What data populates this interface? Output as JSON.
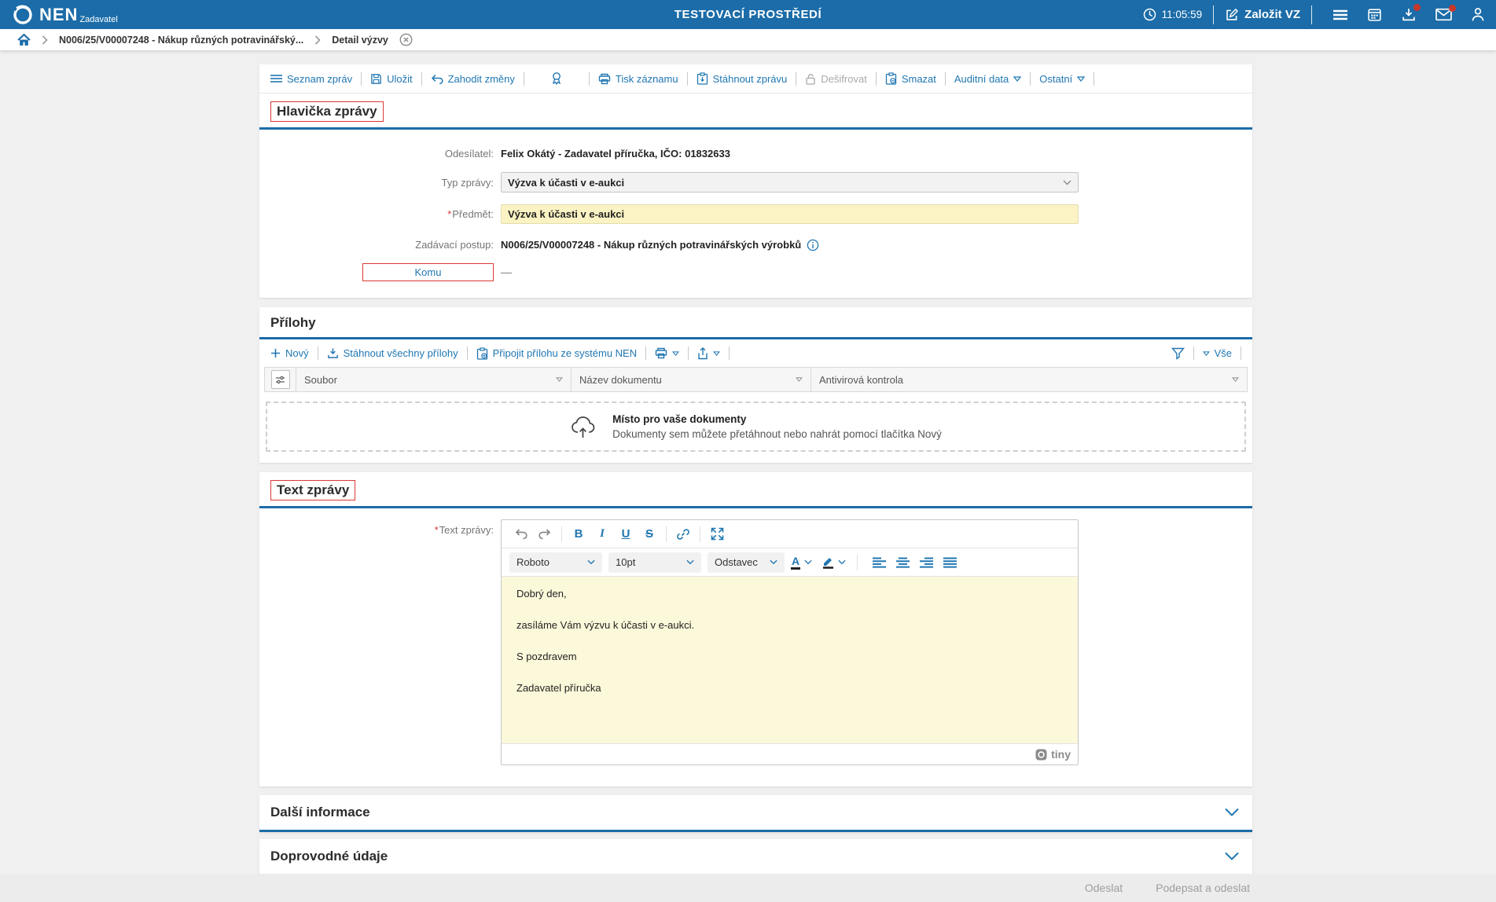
{
  "header": {
    "brand": "NEN",
    "brand_sub": "Zadavatel",
    "env_title": "TESTOVACÍ PROSTŘEDÍ",
    "time": "11:05:59",
    "create_vz": "Založit VZ"
  },
  "breadcrumb": {
    "procedure": "N006/25/V00007248 - Nákup různých potravinářský...",
    "current": "Detail výzvy"
  },
  "record_toolbar": {
    "seznam_zprav": "Seznam zpráv",
    "ulozit": "Uložit",
    "zahodit_zmeny": "Zahodit změny",
    "tisk_zaznamu": "Tisk záznamu",
    "stahnout_zpravu": "Stáhnout zprávu",
    "desifrovat": "Dešifrovat",
    "smazat": "Smazat",
    "auditni_data": "Auditní data",
    "ostatni": "Ostatní"
  },
  "hlavicka": {
    "title": "Hlavička zprávy",
    "required_marker": "*",
    "odesilatel_label": "Odesílatel:",
    "odesilatel_value": "Felix Okátý - Zadavatel příručka, IČO: 01832633",
    "typ_zpravy_label": "Typ zprávy:",
    "typ_zpravy_value": "Výzva k účasti v e-aukci",
    "predmet_label": "Předmět:",
    "predmet_value": "Výzva k účasti v e-aukci",
    "zadavaci_postup_label": "Zadávací postup:",
    "zadavaci_postup_value": "N006/25/V00007248 - Nákup různých potravinářských výrobků",
    "komu_label": "Komu",
    "komu_value": "—"
  },
  "prilohy": {
    "title": "Přílohy",
    "novy": "Nový",
    "stahnout_vsechny": "Stáhnout všechny přílohy",
    "pripojit": "Připojit přílohu ze systému NEN",
    "vse": "Vše",
    "columns": [
      "Soubor",
      "Název dokumentu",
      "Antivirová kontrola"
    ],
    "dropzone_title": "Místo pro vaše dokumenty",
    "dropzone_hint": "Dokumenty sem můžete přetáhnout nebo nahrát pomocí tlačítka Nový"
  },
  "text_zpravy": {
    "title": "Text zprávy",
    "required_marker": "*",
    "field_label": "Text zprávy:",
    "editor": {
      "font_name": "Roboto",
      "font_size": "10pt",
      "block_format": "Odstavec",
      "lines": [
        "Dobrý den,",
        "zasíláme Vám výzvu k účasti v e-aukci.",
        "S pozdravem",
        "Zadavatel příručka"
      ],
      "brand": "tiny"
    }
  },
  "collapsed_sections": {
    "dalsi_informace": "Další informace",
    "doprovodne_udaje": "Doprovodné údaje"
  },
  "footer": {
    "odeslat": "Odeslat",
    "podepsat_a_odeslat": "Podepsat a odeslat"
  },
  "colors": {
    "header_blue": "#1b6ca8",
    "link_blue": "#2077b2",
    "section_rule_blue": "#1b6ca8",
    "annotation_red": "#d93a35",
    "field_yellow": "#fbf3c3",
    "editor_yellow": "#fcf8da",
    "badge_red": "#c9372c"
  }
}
